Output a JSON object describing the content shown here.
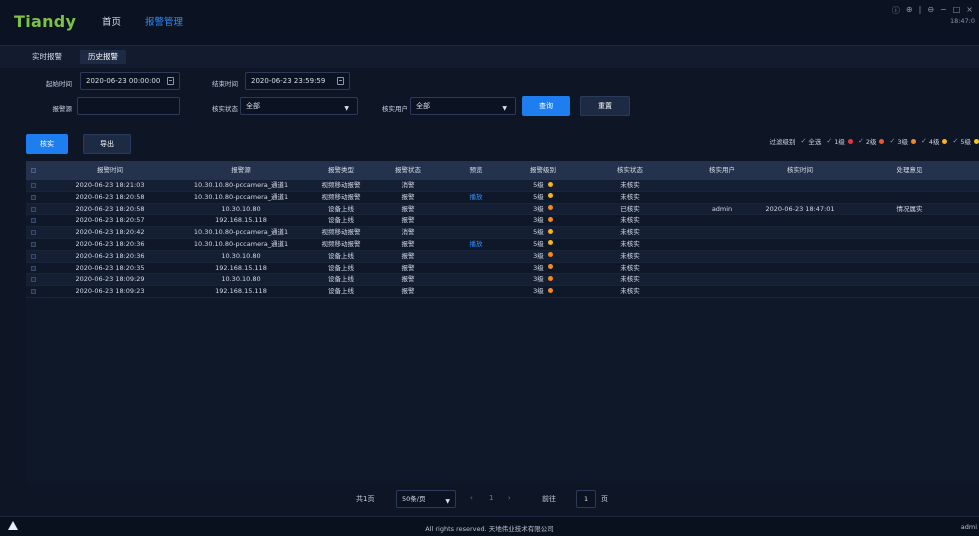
{
  "app": {
    "logo": "Tiandy",
    "nav": [
      "首页",
      "报警管理"
    ],
    "active_nav": 1,
    "window_controls": [
      "ⓘ",
      "⊕",
      "|",
      "⊖",
      "−",
      "□",
      "×"
    ],
    "clock": "18:47:0"
  },
  "subtabs": [
    "实时报警",
    "历史报警"
  ],
  "active_subtab": 1,
  "filters": {
    "start_label": "起始时间",
    "start_value": "2020-06-23 00:00:00",
    "end_label": "结束时间",
    "end_value": "2020-06-23 23:59:59",
    "source_label": "报警源",
    "source_value": "",
    "verify_status_label": "核实状态",
    "verify_status_value": "全部",
    "verify_user_label": "核实用户",
    "verify_user_value": "全部",
    "query_button": "查询",
    "reset_button": "重置"
  },
  "actions": {
    "verify_button": "核实",
    "export_button": "导出",
    "filter_label": "过滤级别",
    "levels": [
      {
        "label": "全选",
        "color": ""
      },
      {
        "label": "1级",
        "color": "#e23b3b"
      },
      {
        "label": "2级",
        "color": "#ef5a2b"
      },
      {
        "label": "3级",
        "color": "#f08a24"
      },
      {
        "label": "4级",
        "color": "#f5b320"
      },
      {
        "label": "5级",
        "color": "#f5c518"
      }
    ]
  },
  "table": {
    "columns": [
      "报警时间",
      "报警源",
      "报警类型",
      "报警状态",
      "预览",
      "报警级别",
      "核实状态",
      "核实用户",
      "核实时间",
      "处理意见"
    ],
    "rows": [
      {
        "time": "2020-06-23 18:21:03",
        "source": "10.30.10.80-pccamera_通道1",
        "type": "视频移动报警",
        "status": "消警",
        "preview": "",
        "level": "5级",
        "level_color": "#f5b320",
        "verify": "未核实",
        "user": "",
        "vtime": "",
        "opinion": ""
      },
      {
        "time": "2020-06-23 18:20:58",
        "source": "10.30.10.80-pccamera_通道1",
        "type": "视频移动报警",
        "status": "报警",
        "preview": "播放",
        "level": "5级",
        "level_color": "#f5b320",
        "verify": "未核实",
        "user": "",
        "vtime": "",
        "opinion": ""
      },
      {
        "time": "2020-06-23 18:20:58",
        "source": "10.30.10.80",
        "type": "设备上线",
        "status": "报警",
        "preview": "",
        "level": "3级",
        "level_color": "#f08a24",
        "verify": "已核实",
        "user": "admin",
        "vtime": "2020-06-23 18:47:01",
        "opinion": "情况属实"
      },
      {
        "time": "2020-06-23 18:20:57",
        "source": "192.168.15.118",
        "type": "设备上线",
        "status": "报警",
        "preview": "",
        "level": "3级",
        "level_color": "#f08a24",
        "verify": "未核实",
        "user": "",
        "vtime": "",
        "opinion": ""
      },
      {
        "time": "2020-06-23 18:20:42",
        "source": "10.30.10.80-pccamera_通道1",
        "type": "视频移动报警",
        "status": "消警",
        "preview": "",
        "level": "5级",
        "level_color": "#f5b320",
        "verify": "未核实",
        "user": "",
        "vtime": "",
        "opinion": ""
      },
      {
        "time": "2020-06-23 18:20:36",
        "source": "10.30.10.80-pccamera_通道1",
        "type": "视频移动报警",
        "status": "报警",
        "preview": "播放",
        "level": "5级",
        "level_color": "#f5b320",
        "verify": "未核实",
        "user": "",
        "vtime": "",
        "opinion": ""
      },
      {
        "time": "2020-06-23 18:20:36",
        "source": "10.30.10.80",
        "type": "设备上线",
        "status": "报警",
        "preview": "",
        "level": "3级",
        "level_color": "#f08a24",
        "verify": "未核实",
        "user": "",
        "vtime": "",
        "opinion": ""
      },
      {
        "time": "2020-06-23 18:20:35",
        "source": "192.168.15.118",
        "type": "设备上线",
        "status": "报警",
        "preview": "",
        "level": "3级",
        "level_color": "#f08a24",
        "verify": "未核实",
        "user": "",
        "vtime": "",
        "opinion": ""
      },
      {
        "time": "2020-06-23 18:09:29",
        "source": "10.30.10.80",
        "type": "设备上线",
        "status": "报警",
        "preview": "",
        "level": "3级",
        "level_color": "#f08a24",
        "verify": "未核实",
        "user": "",
        "vtime": "",
        "opinion": ""
      },
      {
        "time": "2020-06-23 18:09:23",
        "source": "192.168.15.118",
        "type": "设备上线",
        "status": "报警",
        "preview": "",
        "level": "3级",
        "level_color": "#f08a24",
        "verify": "未核实",
        "user": "",
        "vtime": "",
        "opinion": ""
      }
    ]
  },
  "pagination": {
    "total": "共1页",
    "page_size": "50条/页",
    "prev": "‹",
    "current": "1",
    "next": "›",
    "goto_label": "前往",
    "goto_value": "1",
    "page_unit": "页"
  },
  "footer": {
    "copyright": "All rights reserved. 天地伟业技术有限公司",
    "user": "admi"
  }
}
